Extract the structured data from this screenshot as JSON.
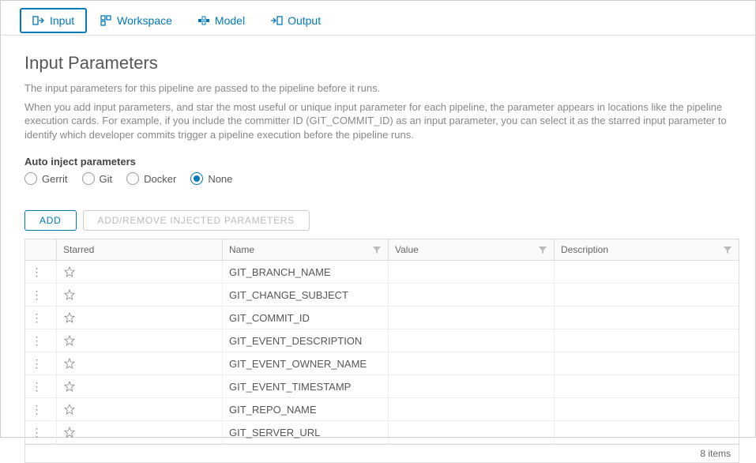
{
  "tabs": [
    {
      "label": "Input",
      "active": true
    },
    {
      "label": "Workspace",
      "active": false
    },
    {
      "label": "Model",
      "active": false
    },
    {
      "label": "Output",
      "active": false
    }
  ],
  "page": {
    "title": "Input Parameters",
    "help1": "The input parameters for this pipeline are passed to the pipeline before it runs.",
    "help2": "When you add input parameters, and star the most useful or unique input parameter for each pipeline, the parameter appears in locations like the pipeline execution cards. For example, if you include the committer ID (GIT_COMMIT_ID) as an input parameter, you can select it as the starred input parameter to identify which developer commits trigger a pipeline execution before the pipeline runs."
  },
  "autoInject": {
    "label": "Auto inject parameters",
    "options": [
      "Gerrit",
      "Git",
      "Docker",
      "None"
    ],
    "selected": "None"
  },
  "buttons": {
    "add": "ADD",
    "addRemove": "ADD/REMOVE INJECTED PARAMETERS"
  },
  "columns": {
    "starred": "Starred",
    "name": "Name",
    "value": "Value",
    "description": "Description"
  },
  "rows": [
    {
      "name": "GIT_BRANCH_NAME",
      "value": "",
      "description": "",
      "starred": false
    },
    {
      "name": "GIT_CHANGE_SUBJECT",
      "value": "",
      "description": "",
      "starred": false
    },
    {
      "name": "GIT_COMMIT_ID",
      "value": "",
      "description": "",
      "starred": false
    },
    {
      "name": "GIT_EVENT_DESCRIPTION",
      "value": "",
      "description": "",
      "starred": false
    },
    {
      "name": "GIT_EVENT_OWNER_NAME",
      "value": "",
      "description": "",
      "starred": false
    },
    {
      "name": "GIT_EVENT_TIMESTAMP",
      "value": "",
      "description": "",
      "starred": false
    },
    {
      "name": "GIT_REPO_NAME",
      "value": "",
      "description": "",
      "starred": false
    },
    {
      "name": "GIT_SERVER_URL",
      "value": "",
      "description": "",
      "starred": false
    }
  ],
  "footer": {
    "items_label": "8 items"
  }
}
